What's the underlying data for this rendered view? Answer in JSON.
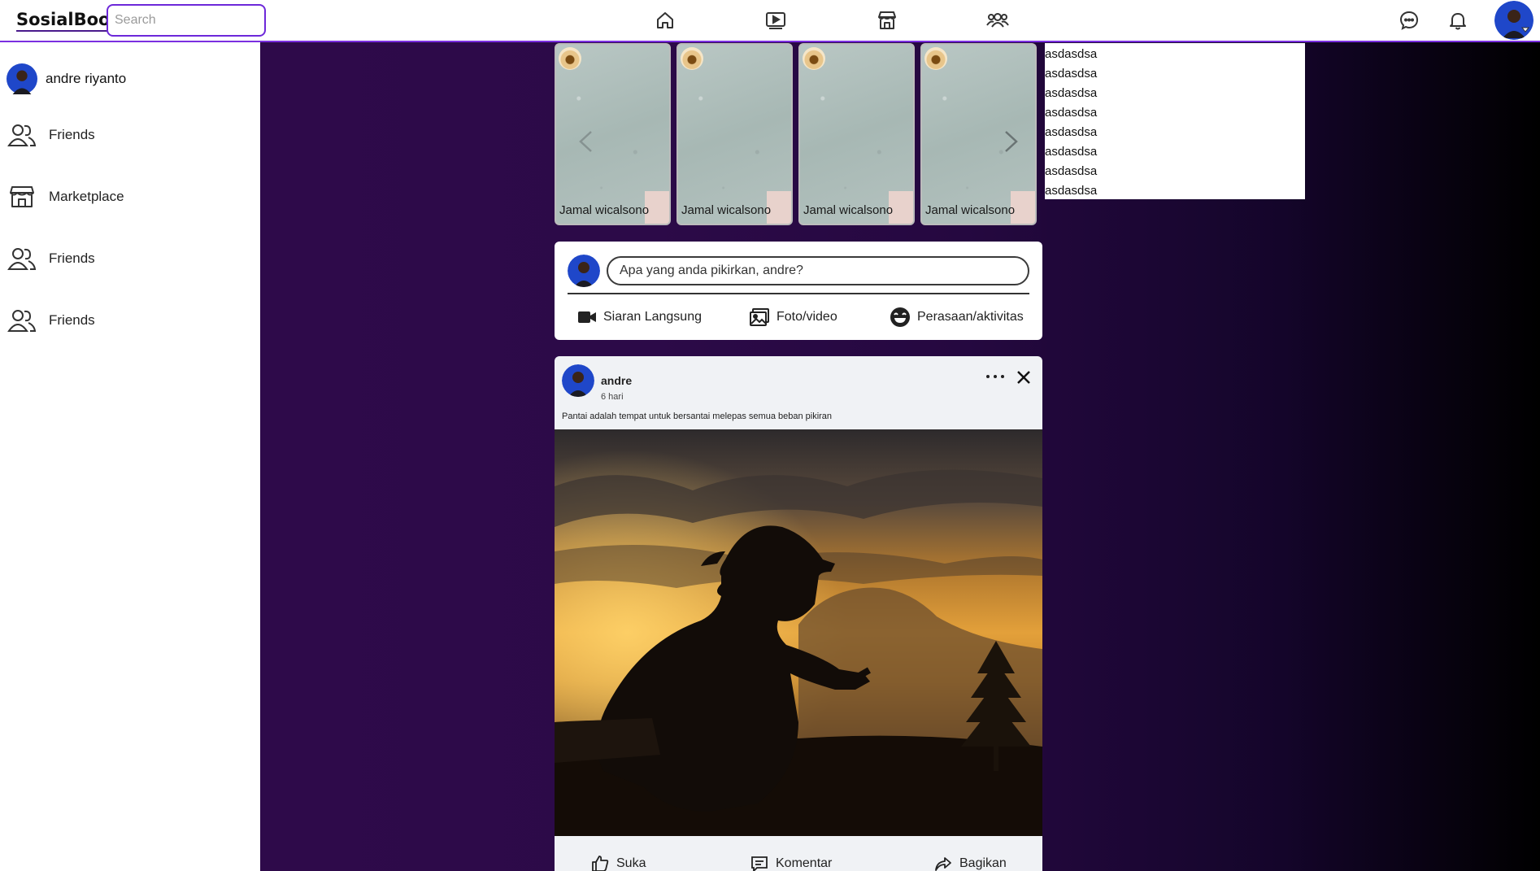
{
  "app": {
    "logo": "SosialBook",
    "search_placeholder": "Search"
  },
  "nav": {
    "icons": [
      "home-icon",
      "video-icon",
      "marketplace-icon",
      "groups-icon"
    ],
    "right_icons": [
      "messenger-icon",
      "bell-icon"
    ]
  },
  "sidebar": {
    "user_name": "andre riyanto",
    "items": [
      {
        "label": "Friends",
        "icon": "friends-icon"
      },
      {
        "label": "Marketplace",
        "icon": "marketplace-icon"
      },
      {
        "label": "Friends",
        "icon": "friends-icon"
      },
      {
        "label": "Friends",
        "icon": "friends-icon"
      }
    ]
  },
  "stories": [
    {
      "name": "Jamal wicalsono"
    },
    {
      "name": "Jamal wicalsono"
    },
    {
      "name": "Jamal wicalsono"
    },
    {
      "name": "Jamal wicalsono"
    }
  ],
  "dropdown": {
    "items": [
      "asdasdsa",
      "asdasdsa",
      "asdasdsa",
      "asdasdsa",
      "asdasdsa",
      "asdasdsa",
      "asdasdsa",
      "asdasdsa"
    ]
  },
  "composer": {
    "placeholder": "Apa yang anda pikirkan, andre?",
    "actions": [
      {
        "label": "Siaran Langsung",
        "icon": "live-video-icon"
      },
      {
        "label": "Foto/video",
        "icon": "photo-icon"
      },
      {
        "label": "Perasaan/aktivitas",
        "icon": "smiley-icon"
      }
    ]
  },
  "post": {
    "author": "andre",
    "time": "6 hari",
    "caption": "Pantai adalah tempat untuk bersantai melepas semua beban pikiran",
    "actions": [
      {
        "label": "Suka",
        "icon": "like-icon"
      },
      {
        "label": "Komentar",
        "icon": "comment-icon"
      },
      {
        "label": "Bagikan",
        "icon": "share-icon"
      }
    ]
  },
  "colors": {
    "accent": "#7b2fe0",
    "main_bg": "#2e0a4a",
    "avatar_blue": "#1f47c9"
  }
}
